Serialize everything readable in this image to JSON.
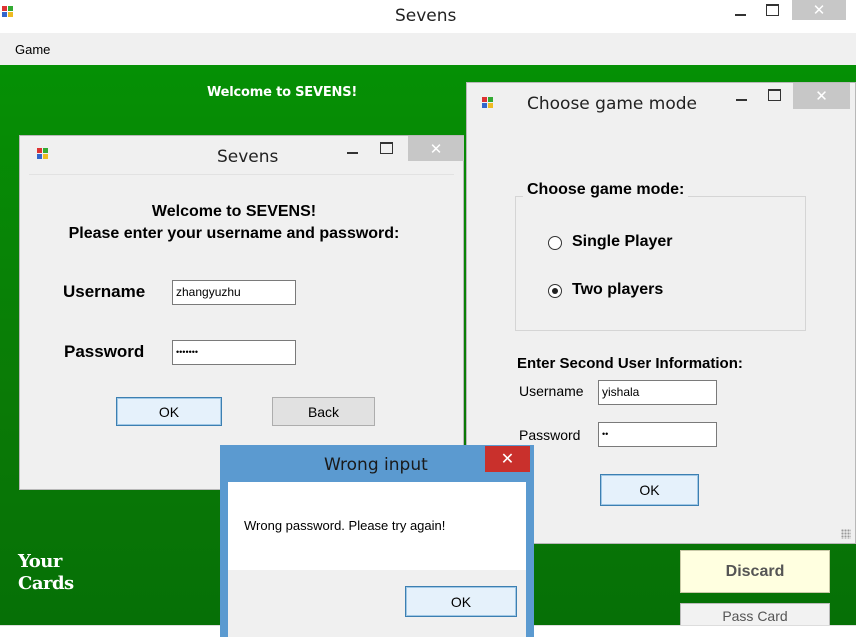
{
  "main_window": {
    "title": "Sevens",
    "menu": [
      "Game"
    ],
    "welcome_banner": "Welcome to SEVENS!",
    "your_cards_label_line1": "Your",
    "your_cards_label_line2": "Cards",
    "discard_label": "Discard",
    "pass_card_label": "Pass Card",
    "background_color": "#078a07"
  },
  "login_dialog": {
    "title": "Sevens",
    "heading_line1": "Welcome to SEVENS!",
    "heading_line2": "Please enter your username and password:",
    "username_label": "Username",
    "username_value": "zhangyuzhu",
    "password_label": "Password",
    "password_value": "•••••••",
    "ok_label": "OK",
    "back_label": "Back"
  },
  "mode_dialog": {
    "title": "Choose game mode",
    "group_caption": "Choose game mode:",
    "options": [
      {
        "label": "Single Player",
        "checked": false
      },
      {
        "label": "Two players",
        "checked": true
      }
    ],
    "second_user_heading": "Enter Second User Information:",
    "username_label": "Username",
    "username_value": "yishala",
    "password_label": "Password",
    "password_value": "••",
    "ok_label": "OK"
  },
  "error_dialog": {
    "title": "Wrong input",
    "message": "Wrong password. Please try again!",
    "ok_label": "OK",
    "close_symbol": "✕"
  },
  "icons": {
    "close": "✕"
  }
}
